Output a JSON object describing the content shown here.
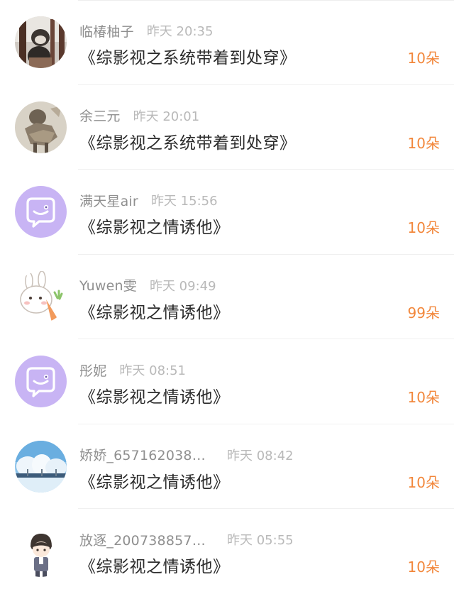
{
  "entries": [
    {
      "username": "临椿柚子",
      "time": "昨天 20:35",
      "book": "《综影视之系统带着到处穿》",
      "amount": "10朵",
      "avatar_icon": "photo-avatar-cat-window"
    },
    {
      "username": "余三元",
      "time": "昨天 20:01",
      "book": "《综影视之系统带着到处穿》",
      "amount": "10朵",
      "avatar_icon": "photo-avatar-sketch"
    },
    {
      "username": "满天星air",
      "time": "昨天 15:56",
      "book": "《综影视之情诱他》",
      "amount": "10朵",
      "avatar_icon": "default-chat-bubble-avatar"
    },
    {
      "username": "Yuwen雯",
      "time": "昨天 09:49",
      "book": "《综影视之情诱他》",
      "amount": "99朵",
      "avatar_icon": "cartoon-rabbit-carrot-avatar"
    },
    {
      "username": "彤妮",
      "time": "昨天 08:51",
      "book": "《综影视之情诱他》",
      "amount": "10朵",
      "avatar_icon": "default-chat-bubble-avatar"
    },
    {
      "username": "娇娇_657162038…",
      "time": "昨天 08:42",
      "book": "《综影视之情诱他》",
      "amount": "10朵",
      "avatar_icon": "photo-avatar-snow-trees"
    },
    {
      "username": "放逐_200738857…",
      "time": "昨天 05:55",
      "book": "《综影视之情诱他》",
      "amount": "10朵",
      "avatar_icon": "cartoon-boy-avatar"
    }
  ],
  "colors": {
    "amount": "#f2873b",
    "username": "#8f8f8f",
    "time": "#b9b9b9",
    "title": "#2b2b2b",
    "default_avatar_bg": "#c8b4f4"
  }
}
